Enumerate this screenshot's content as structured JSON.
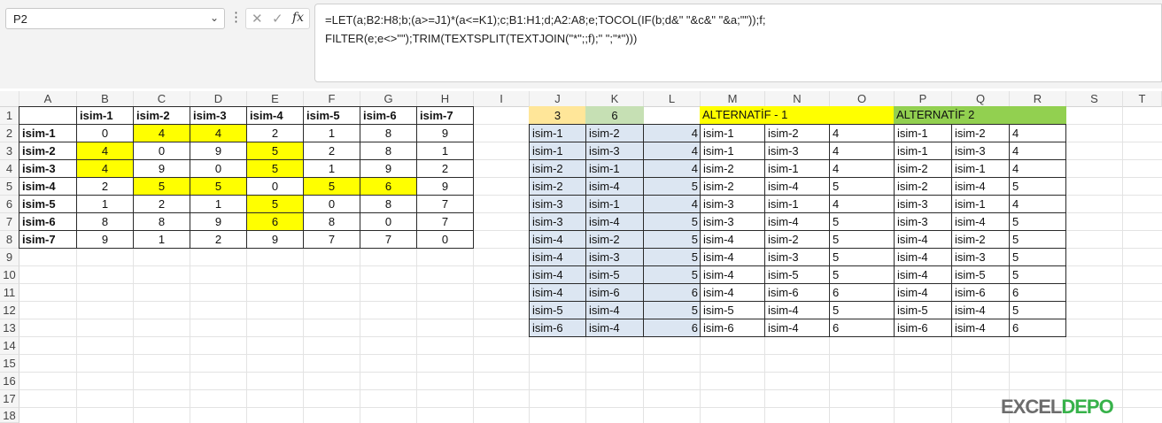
{
  "name_box": {
    "value": "P2"
  },
  "formula_bar": {
    "more_glyph": "⋮",
    "cancel_glyph": "✕",
    "enter_glyph": "✓",
    "fx_glyph": "fx",
    "line1": "=LET(a;B2:H8;b;(a>=J1)*(a<=K1);c;B1:H1;d;A2:A8;e;TOCOL(IF(b;d&\" \"&c&\" \"&a;\"\"));f;",
    "line2": "FILTER(e;e<>\"\");TRIM(TEXTSPLIT(TEXTJOIN(\"*\";;f);\" \";\"*\")))"
  },
  "columns": [
    "A",
    "B",
    "C",
    "D",
    "E",
    "F",
    "G",
    "H",
    "I",
    "J",
    "K",
    "L",
    "M",
    "N",
    "O",
    "P",
    "Q",
    "R",
    "S",
    "T"
  ],
  "rows": [
    "1",
    "2",
    "3",
    "4",
    "5",
    "6",
    "7",
    "8",
    "9",
    "10",
    "11",
    "12",
    "13",
    "14",
    "15",
    "16",
    "17",
    "18"
  ],
  "matrix": {
    "col_headers": [
      "isim-1",
      "isim-2",
      "isim-3",
      "isim-4",
      "isim-5",
      "isim-6",
      "isim-7"
    ],
    "row_headers": [
      "isim-1",
      "isim-2",
      "isim-3",
      "isim-4",
      "isim-5",
      "isim-6",
      "isim-7"
    ],
    "values": [
      [
        "0",
        "4",
        "4",
        "2",
        "1",
        "8",
        "9"
      ],
      [
        "4",
        "0",
        "9",
        "5",
        "2",
        "8",
        "1"
      ],
      [
        "4",
        "9",
        "0",
        "5",
        "1",
        "9",
        "2"
      ],
      [
        "2",
        "5",
        "5",
        "0",
        "5",
        "6",
        "9"
      ],
      [
        "1",
        "2",
        "1",
        "5",
        "0",
        "8",
        "7"
      ],
      [
        "8",
        "8",
        "9",
        "6",
        "8",
        "0",
        "7"
      ],
      [
        "9",
        "1",
        "2",
        "9",
        "7",
        "7",
        "0"
      ]
    ],
    "highlight_color": "#ffff00"
  },
  "criteria": {
    "min": "3",
    "max": "6",
    "min_color": "#ffe699",
    "max_color": "#c6e0b4"
  },
  "result_main": [
    [
      "isim-1",
      "isim-2",
      "4"
    ],
    [
      "isim-1",
      "isim-3",
      "4"
    ],
    [
      "isim-2",
      "isim-1",
      "4"
    ],
    [
      "isim-2",
      "isim-4",
      "5"
    ],
    [
      "isim-3",
      "isim-1",
      "4"
    ],
    [
      "isim-3",
      "isim-4",
      "5"
    ],
    [
      "isim-4",
      "isim-2",
      "5"
    ],
    [
      "isim-4",
      "isim-3",
      "5"
    ],
    [
      "isim-4",
      "isim-5",
      "5"
    ],
    [
      "isim-4",
      "isim-6",
      "6"
    ],
    [
      "isim-5",
      "isim-4",
      "5"
    ],
    [
      "isim-6",
      "isim-4",
      "6"
    ]
  ],
  "alt1": {
    "title": "ALTERNATİF - 1",
    "color": "#ffff00",
    "rows": [
      [
        "isim-1",
        "isim-2",
        "4"
      ],
      [
        "isim-1",
        "isim-3",
        "4"
      ],
      [
        "isim-2",
        "isim-1",
        "4"
      ],
      [
        "isim-2",
        "isim-4",
        "5"
      ],
      [
        "isim-3",
        "isim-1",
        "4"
      ],
      [
        "isim-3",
        "isim-4",
        "5"
      ],
      [
        "isim-4",
        "isim-2",
        "5"
      ],
      [
        "isim-4",
        "isim-3",
        "5"
      ],
      [
        "isim-4",
        "isim-5",
        "5"
      ],
      [
        "isim-4",
        "isim-6",
        "6"
      ],
      [
        "isim-5",
        "isim-4",
        "5"
      ],
      [
        "isim-6",
        "isim-4",
        "6"
      ]
    ]
  },
  "alt2": {
    "title": "ALTERNATİF 2",
    "color": "#92d050",
    "rows": [
      [
        "isim-1",
        "isim-2",
        "4"
      ],
      [
        "isim-1",
        "isim-3",
        "4"
      ],
      [
        "isim-2",
        "isim-1",
        "4"
      ],
      [
        "isim-2",
        "isim-4",
        "5"
      ],
      [
        "isim-3",
        "isim-1",
        "4"
      ],
      [
        "isim-3",
        "isim-4",
        "5"
      ],
      [
        "isim-4",
        "isim-2",
        "5"
      ],
      [
        "isim-4",
        "isim-3",
        "5"
      ],
      [
        "isim-4",
        "isim-5",
        "5"
      ],
      [
        "isim-4",
        "isim-6",
        "6"
      ],
      [
        "isim-5",
        "isim-4",
        "5"
      ],
      [
        "isim-6",
        "isim-4",
        "6"
      ]
    ]
  },
  "watermark": {
    "part1": "EXCEL",
    "part2": "DEPO"
  }
}
